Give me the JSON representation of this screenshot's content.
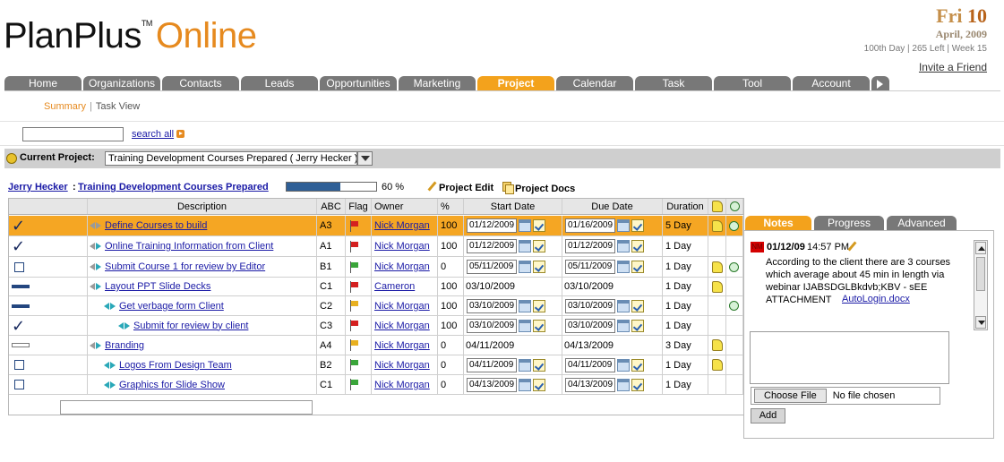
{
  "header": {
    "logo_main": "PlanPlus",
    "logo_tm": "TM",
    "logo_online": "Online",
    "day_name": "Fri",
    "day_num": "10",
    "month_year": "April, 2009",
    "day_stats": "100th Day | 265 Left | Week 15",
    "invite_link": "Invite a Friend"
  },
  "nav": {
    "tabs": [
      "Home",
      "Organizations",
      "Contacts",
      "Leads",
      "Opportunities",
      "Marketing",
      "Project",
      "Calendar",
      "Task",
      "Tool",
      "Account"
    ],
    "active_tab": "Project",
    "more_icon": "right-arrow-icon"
  },
  "subnav": {
    "summary": "Summary",
    "separator": "|",
    "task_view": "Task View"
  },
  "search": {
    "value": "",
    "link": "search all"
  },
  "current_project": {
    "label": "Current Project:",
    "selected": "Training Development Courses Prepared ( Jerry Hecker )"
  },
  "project": {
    "owner": "Jerry Hecker",
    "colon": ":",
    "name": "Training Development Courses Prepared",
    "progress": 0.6,
    "progress_text": "60 %",
    "edit_label": "Project Edit",
    "docs_label": "Project Docs"
  },
  "grid": {
    "columns": [
      "Description",
      "ABC",
      "Flag",
      "Owner",
      "%",
      "Start Date",
      "Due Date",
      "Duration"
    ],
    "rows": [
      {
        "status": "check",
        "desc": "Define Courses to build",
        "indent": 0,
        "arrows": "grey",
        "abc": "A3",
        "flag": "#d42020",
        "owner": "Nick Morgan",
        "pct": "100",
        "start": "01/12/2009",
        "start_edit": true,
        "due": "01/16/2009",
        "due_edit": true,
        "duration": "5 Day",
        "note": true,
        "clock": true,
        "selected": true
      },
      {
        "status": "check",
        "desc": "Online Training Information from Client",
        "indent": 0,
        "arrows": "grey-teal",
        "abc": "A1",
        "flag": "#d42020",
        "owner": "Nick Morgan",
        "pct": "100",
        "start": "01/12/2009",
        "start_edit": true,
        "due": "01/12/2009",
        "due_edit": true,
        "duration": "1 Day",
        "note": false,
        "clock": false,
        "selected": false
      },
      {
        "status": "box",
        "desc": "Submit Course 1 for review by Editor",
        "indent": 0,
        "arrows": "grey-teal",
        "abc": "B1",
        "flag": "#3aa53a",
        "owner": "Nick Morgan",
        "pct": "0",
        "start": "05/11/2009",
        "start_edit": true,
        "due": "05/11/2009",
        "due_edit": true,
        "duration": "1 Day",
        "note": true,
        "clock": true,
        "selected": false
      },
      {
        "status": "dash",
        "desc": "Layout PPT Slide Decks",
        "indent": 0,
        "arrows": "grey-teal",
        "abc": "C1",
        "flag": "#d42020",
        "owner": "Cameron",
        "pct": "100",
        "start": "03/10/2009",
        "start_edit": false,
        "due": "03/10/2009",
        "due_edit": false,
        "duration": "1 Day",
        "note": true,
        "clock": false,
        "selected": false
      },
      {
        "status": "dash",
        "desc": "Get verbage form Client",
        "indent": 1,
        "arrows": "teal",
        "abc": "C2",
        "flag": "#e8b020",
        "owner": "Nick Morgan",
        "pct": "100",
        "start": "03/10/2009",
        "start_edit": true,
        "due": "03/10/2009",
        "due_edit": true,
        "duration": "1 Day",
        "note": false,
        "clock": true,
        "selected": false
      },
      {
        "status": "check",
        "desc": "Submit for review by client",
        "indent": 2,
        "arrows": "teal",
        "abc": "C3",
        "flag": "#d42020",
        "owner": "Nick Morgan",
        "pct": "100",
        "start": "03/10/2009",
        "start_edit": true,
        "due": "03/10/2009",
        "due_edit": true,
        "duration": "1 Day",
        "note": false,
        "clock": false,
        "selected": false
      },
      {
        "status": "empty",
        "desc": "Branding",
        "indent": 0,
        "arrows": "grey-teal",
        "abc": "A4",
        "flag": "#e8b020",
        "owner": "Nick Morgan",
        "pct": "0",
        "start": "04/11/2009",
        "start_edit": false,
        "due": "04/13/2009",
        "due_edit": false,
        "duration": "3 Day",
        "note": true,
        "clock": false,
        "selected": false
      },
      {
        "status": "box",
        "desc": "Logos From Design Team",
        "indent": 1,
        "arrows": "teal",
        "abc": "B2",
        "flag": "#3aa53a",
        "owner": "Nick Morgan",
        "pct": "0",
        "start": "04/11/2009",
        "start_edit": true,
        "due": "04/11/2009",
        "due_edit": true,
        "duration": "1 Day",
        "note": true,
        "clock": false,
        "selected": false
      },
      {
        "status": "box",
        "desc": "Graphics for Slide Show",
        "indent": 1,
        "arrows": "teal",
        "abc": "C1",
        "flag": "#3aa53a",
        "owner": "Nick Morgan",
        "pct": "0",
        "start": "04/13/2009",
        "start_edit": true,
        "due": "04/13/2009",
        "due_edit": true,
        "duration": "1 Day",
        "note": false,
        "clock": false,
        "selected": false
      }
    ]
  },
  "notes_panel": {
    "tabs": [
      "Notes",
      "Progress",
      "Advanced"
    ],
    "active_tab": "Notes",
    "badge": "NM",
    "date": "01/12/09",
    "time": "14:57 PM",
    "text": "According to the client there are 3 courses\nwhich average about 45 min in length via\nwebinar IJABSDGLBkdvb;KBV - sEE\nATTACHMENT",
    "attachment": "AutoLogin.docx",
    "textarea_value": "",
    "choose_file": "Choose File",
    "no_file": "No file chosen",
    "add": "Add"
  },
  "colors": {
    "accent": "#f3a21c",
    "tab_grey": "#787878",
    "link": "#1a1aa6",
    "progress": "#2f5f96"
  }
}
